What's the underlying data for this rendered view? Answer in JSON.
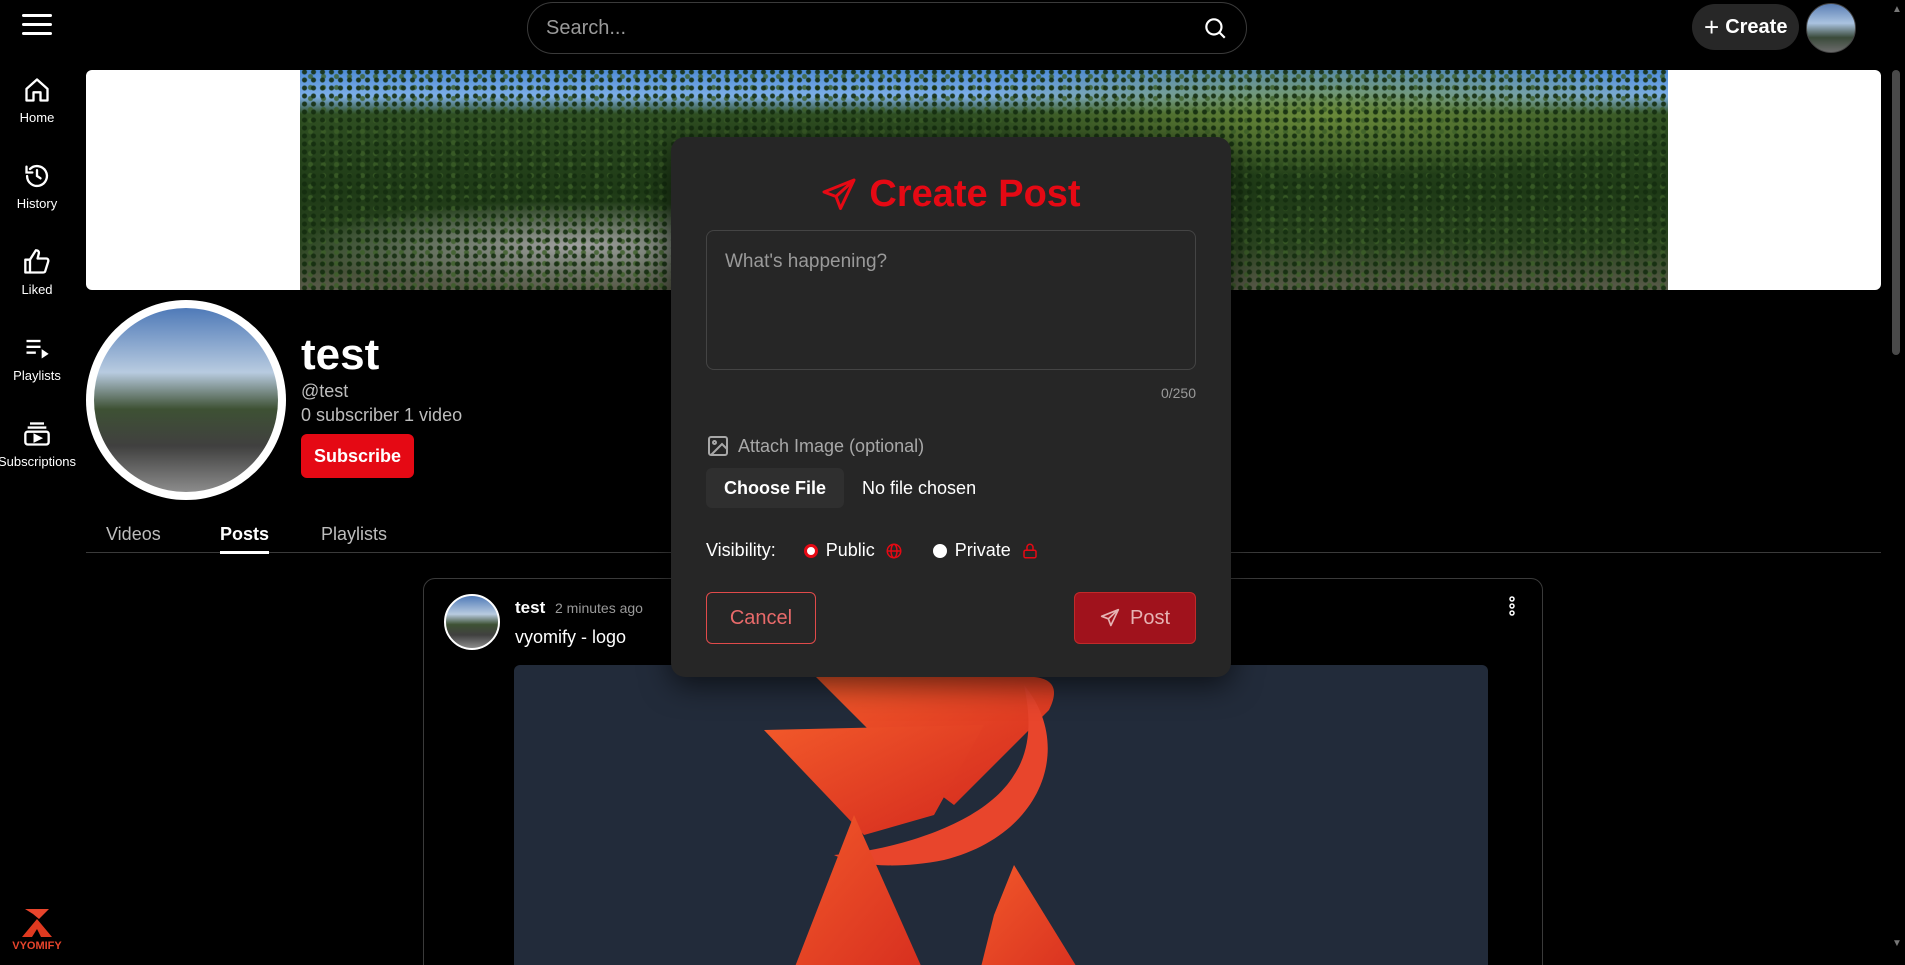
{
  "header": {
    "search_placeholder": "Search...",
    "create_label": "Create"
  },
  "sidebar": {
    "items": [
      {
        "label": "Home",
        "icon": "home-icon"
      },
      {
        "label": "History",
        "icon": "history-icon"
      },
      {
        "label": "Liked",
        "icon": "thumbs-up-icon"
      },
      {
        "label": "Playlists",
        "icon": "playlist-icon"
      },
      {
        "label": "Subscriptions",
        "icon": "subscriptions-icon"
      }
    ],
    "brand": "VYOMIFY"
  },
  "channel": {
    "name": "test",
    "handle": "@test",
    "stats": "0 subscriber 1 video",
    "subscribe_label": "Subscribe"
  },
  "tabs": [
    {
      "label": "Videos",
      "active": false
    },
    {
      "label": "Posts",
      "active": true
    },
    {
      "label": "Playlists",
      "active": false
    }
  ],
  "post": {
    "user": "test",
    "time": "2 minutes ago",
    "text": "vyomify - logo"
  },
  "modal": {
    "title": "Create Post",
    "placeholder": "What's happening?",
    "counter": "0/250",
    "attach_label": "Attach Image (optional)",
    "choose_file_label": "Choose File",
    "no_file_label": "No file chosen",
    "visibility_label": "Visibility:",
    "options": [
      {
        "label": "Public",
        "checked": true,
        "icon": "globe-icon"
      },
      {
        "label": "Private",
        "checked": false,
        "icon": "lock-icon"
      }
    ],
    "cancel_label": "Cancel",
    "post_label": "Post"
  },
  "colors": {
    "accent": "#e50914",
    "brand_orange": "#e8452c",
    "modal_bg": "#262626",
    "page_bg": "#000000"
  }
}
